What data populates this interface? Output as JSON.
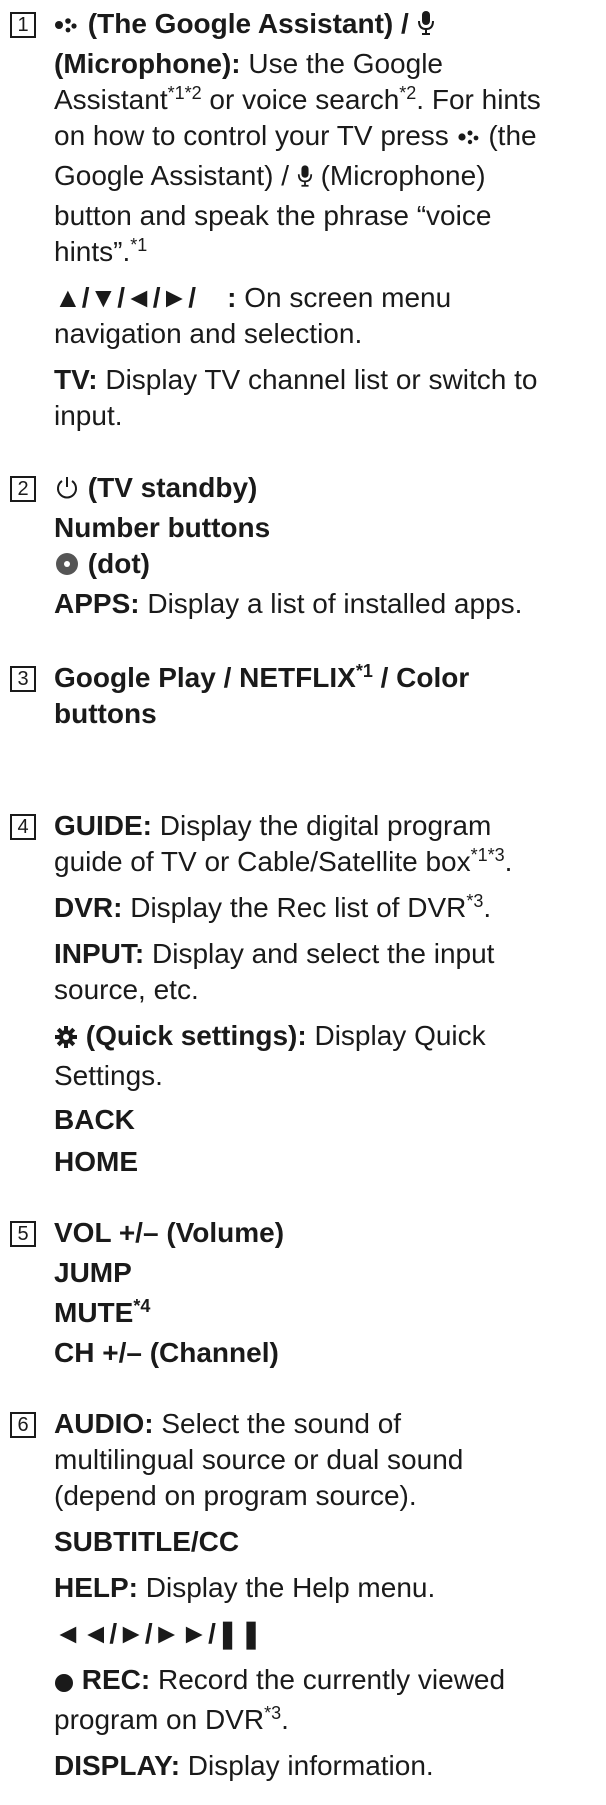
{
  "sections": [
    {
      "number": "1",
      "paras": [
        {
          "lines": [
            [
              "(The Google Assistant) / "
            ],
            [
              "(Microphone):",
              " Use the Google"
            ],
            [
              "Assistant",
              "*1*2",
              " or voice search",
              "*2",
              ". For hints"
            ],
            [
              "on how to control your TV press ",
              " (the"
            ],
            [
              "Google Assistant) / ",
              " (Microphone)"
            ],
            [
              "button and speak the phrase “voice"
            ],
            [
              "hints”.",
              "*1"
            ]
          ]
        },
        {
          "lines": [
            [
              "▲/▼/◄/►/",
              " : ",
              "On screen menu"
            ],
            [
              "navigation and selection."
            ]
          ]
        },
        {
          "lines": [
            [
              "TV:",
              " Display TV channel list or switch to"
            ],
            [
              "input."
            ]
          ]
        }
      ]
    },
    {
      "number": "2",
      "paras": [
        {
          "lines": [
            [
              "(TV standby)"
            ],
            [
              "Number buttons"
            ],
            [
              "(dot)"
            ],
            [
              "APPS:",
              " Display a list of installed apps."
            ]
          ]
        }
      ]
    },
    {
      "number": "3",
      "paras": [
        {
          "lines": [
            [
              "Google Play / NETFLIX",
              "*1",
              " / Color"
            ],
            [
              "buttons"
            ]
          ]
        }
      ]
    },
    {
      "number": "4",
      "paras": [
        {
          "lines": [
            [
              "GUIDE:",
              " Display the digital program"
            ],
            [
              "guide of TV or Cable/Satellite box",
              "*1*3",
              "."
            ]
          ]
        },
        {
          "lines": [
            [
              "DVR:",
              " Display the Rec list of DVR",
              "*3",
              "."
            ]
          ]
        },
        {
          "lines": [
            [
              "INPUT:",
              " Display and select the input"
            ],
            [
              "source, etc."
            ]
          ]
        },
        {
          "lines": [
            [
              "(Quick settings):",
              " Display Quick"
            ],
            [
              "Settings."
            ],
            [
              "BACK"
            ],
            [
              "HOME"
            ]
          ]
        }
      ]
    },
    {
      "number": "5",
      "paras": [
        {
          "lines": [
            [
              "VOL +/– (Volume)"
            ],
            [
              "JUMP"
            ],
            [
              "MUTE",
              "*4"
            ],
            [
              "CH +/– (Channel)"
            ]
          ]
        }
      ]
    },
    {
      "number": "6",
      "paras": [
        {
          "lines": [
            [
              "AUDIO:",
              " Select the sound of"
            ],
            [
              "multilingual source or dual sound"
            ],
            [
              "(depend on program source)."
            ]
          ]
        },
        {
          "lines": [
            [
              "SUBTITLE/CC"
            ]
          ]
        },
        {
          "lines": [
            [
              "HELP:",
              " Display the Help menu."
            ]
          ]
        },
        {
          "lines": [
            [
              "◄◄/►/►►/❚❚"
            ]
          ]
        },
        {
          "lines": [
            [
              "REC:",
              " Record the currently viewed"
            ],
            [
              "program on DVR",
              "*3",
              "."
            ]
          ]
        },
        {
          "lines": [
            [
              "DISPLAY:",
              " Display information."
            ]
          ]
        }
      ]
    }
  ]
}
